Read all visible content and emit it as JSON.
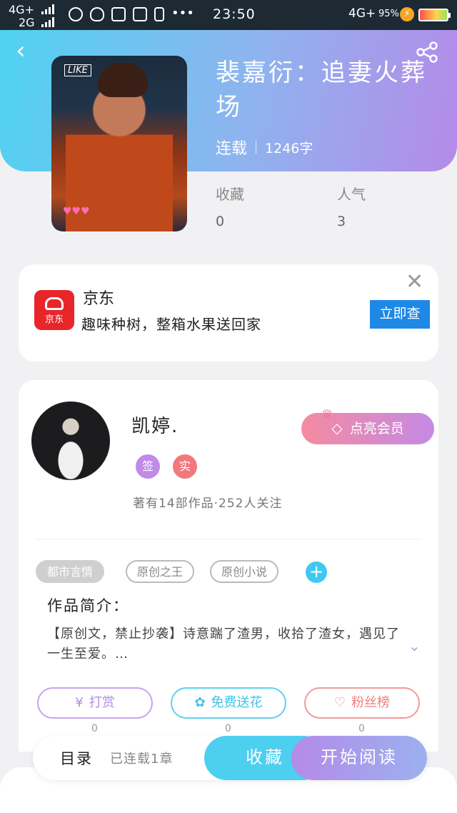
{
  "status_bar": {
    "net_top": "4G+",
    "net_bottom": "2G",
    "time": "23:50",
    "net_right": "4G+",
    "battery_percent": "95%"
  },
  "book": {
    "title": "裴嘉衍：追妻火葬场",
    "status": "连载",
    "word_count": "1246字",
    "favorites_label": "收藏",
    "favorites_value": "0",
    "popularity_label": "人气",
    "popularity_value": "3",
    "cover_text": "LIKE"
  },
  "ad": {
    "brand": "京东",
    "logo_text": "京东",
    "description": "趣味种树，整箱水果送回家",
    "cta": "立即查",
    "brand_color": "#e8262a"
  },
  "author": {
    "name": "凯婷.",
    "badge_sign": "签",
    "badge_real": "实",
    "stats": "著有14部作品·252人关注",
    "vip_button": "点亮会员"
  },
  "tags": [
    "都市言情",
    "原创之王",
    "原创小说"
  ],
  "intro": {
    "heading": "作品简介：",
    "text": "【原创文，禁止抄袭】诗意踹了渣男，收拾了渣女，遇见了一生至爱。…"
  },
  "actions": [
    {
      "label": "打赏",
      "icon": "yen-icon",
      "count": "0"
    },
    {
      "label": "免费送花",
      "icon": "flower-icon",
      "count": "0"
    },
    {
      "label": "粉丝榜",
      "icon": "fan-icon",
      "count": "0"
    }
  ],
  "bottom_bar": {
    "toc": "目录",
    "serial_status": "已连载1章",
    "favorite_button": "收藏",
    "read_button": "开始阅读"
  },
  "colors": {
    "accent_cyan": "#4dcfef",
    "accent_purple": "#b58ae8",
    "vip_pink": "#f48ba0"
  }
}
